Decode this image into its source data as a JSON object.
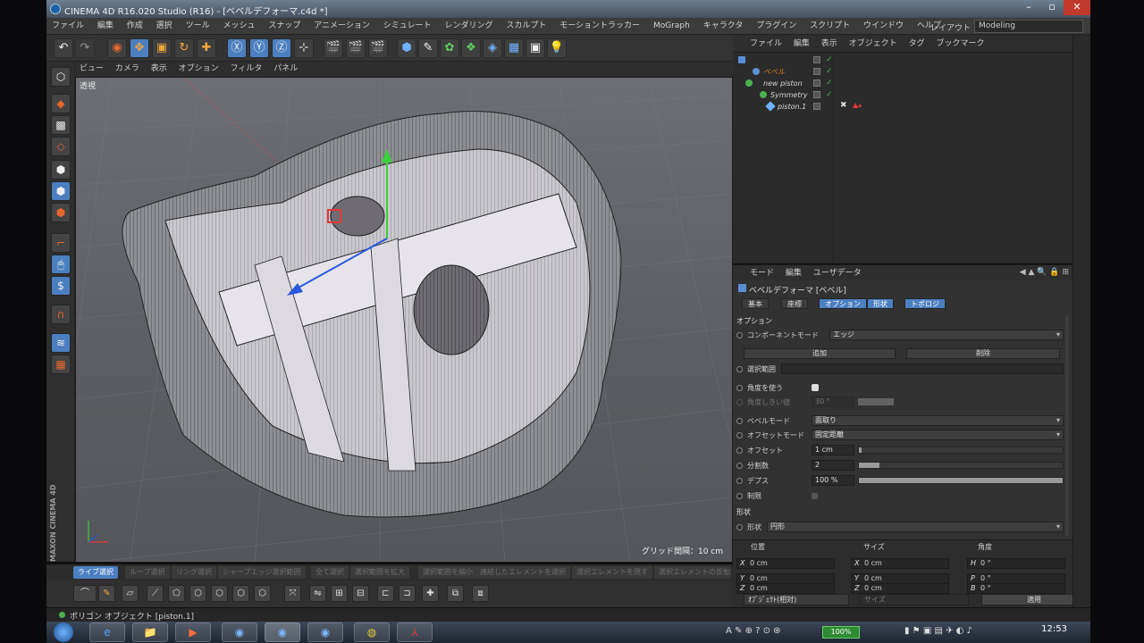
{
  "window": {
    "title": "CINEMA 4D R16.020 Studio (R16) - [ベベルデフォーマ.c4d *]"
  },
  "menu": [
    "ファイル",
    "編集",
    "作成",
    "選択",
    "ツール",
    "メッシュ",
    "スナップ",
    "アニメーション",
    "シミュレート",
    "レンダリング",
    "スカルプト",
    "モーショントラッカー",
    "MoGraph",
    "キャラクタ",
    "プラグイン",
    "スクリプト",
    "ウインドウ",
    "ヘルプ"
  ],
  "layout": {
    "label": "レイアウト",
    "value": "Modeling"
  },
  "viewport": {
    "menu": [
      "ビュー",
      "カメラ",
      "表示",
      "オプション",
      "フィルタ",
      "パネル"
    ],
    "view_name": "透視",
    "grid_spacing": "グリッド間隔：10 cm",
    "brand": "MAXON CINEMA 4D"
  },
  "modes": [
    "ライブ選択",
    "ループ選択",
    "リング選択",
    "シャープエッジ選択範囲",
    "全て選択",
    "選択範囲を拡大",
    "選択範囲を縮小",
    "連結したエレメントを選択",
    "選択エレメントを隠す",
    "選択エレメントの反転"
  ],
  "object_manager": {
    "menu": [
      "ファイル",
      "編集",
      "表示",
      "オブジェクト",
      "タグ",
      "ブックマーク"
    ],
    "objects": [
      {
        "name": "ベベル",
        "color": "#e67e22"
      },
      {
        "name": "new piston",
        "color": "#d8d8d8"
      },
      {
        "name": "Symmetry",
        "color": "#d8d8d8"
      },
      {
        "name": "piston.1",
        "color": "#d8d8d8"
      }
    ]
  },
  "attribute_manager": {
    "menu": [
      "モード",
      "編集",
      "ユーザデータ"
    ],
    "title": "ベベルデフォーマ [ベベル]",
    "tabs": [
      {
        "label": "基本",
        "active": false
      },
      {
        "label": "座標",
        "active": false
      },
      {
        "label": "オプション",
        "active": true
      },
      {
        "label": "形状",
        "active": false
      },
      {
        "label": "トポロジ",
        "active": false
      }
    ],
    "section_options": "オプション",
    "component_mode": {
      "label": "コンポーネントモード",
      "value": "エッジ"
    },
    "add_button": "追加",
    "delete_button": "削除",
    "selection": "選択範囲",
    "use_angle": "角度を使う",
    "angle_threshold": {
      "label": "角度しきい値",
      "value": "30 °"
    },
    "bevel_mode": {
      "label": "ベベルモード",
      "value": "面取り"
    },
    "offset_mode": {
      "label": "オフセットモード",
      "value": "固定距離"
    },
    "offset": {
      "label": "オフセット",
      "value": "1 cm",
      "fill": 0.01
    },
    "subdivision": {
      "label": "分割数",
      "value": "2",
      "fill": 0.1
    },
    "depth": {
      "label": "デプス",
      "value": "100 %",
      "fill": 1.0
    },
    "limit": "制限",
    "section_shape": "形状",
    "shape": {
      "label": "形状",
      "value": "円形"
    }
  },
  "coordinates": {
    "headers": [
      "位置",
      "サイズ",
      "角度"
    ],
    "position": [
      {
        "axis": "X",
        "value": "0 cm"
      },
      {
        "axis": "Y",
        "value": "0 cm"
      },
      {
        "axis": "Z",
        "value": "0 cm"
      }
    ],
    "size": [
      {
        "axis": "X",
        "value": "0 cm"
      },
      {
        "axis": "Y",
        "value": "0 cm"
      },
      {
        "axis": "Z",
        "value": "0 cm"
      }
    ],
    "rotation": [
      {
        "axis": "H",
        "value": "0 °"
      },
      {
        "axis": "P",
        "value": "0 °"
      },
      {
        "axis": "B",
        "value": "0 °"
      }
    ],
    "mode_select": "ｵﾌﾞｼﾞｪｸﾄ(相対)",
    "size_select": "サイズ",
    "apply": "適用"
  },
  "status": "ポリゴン オブジェクト [piston.1]",
  "taskbar": {
    "battery": "100%",
    "clock": "12:53"
  }
}
